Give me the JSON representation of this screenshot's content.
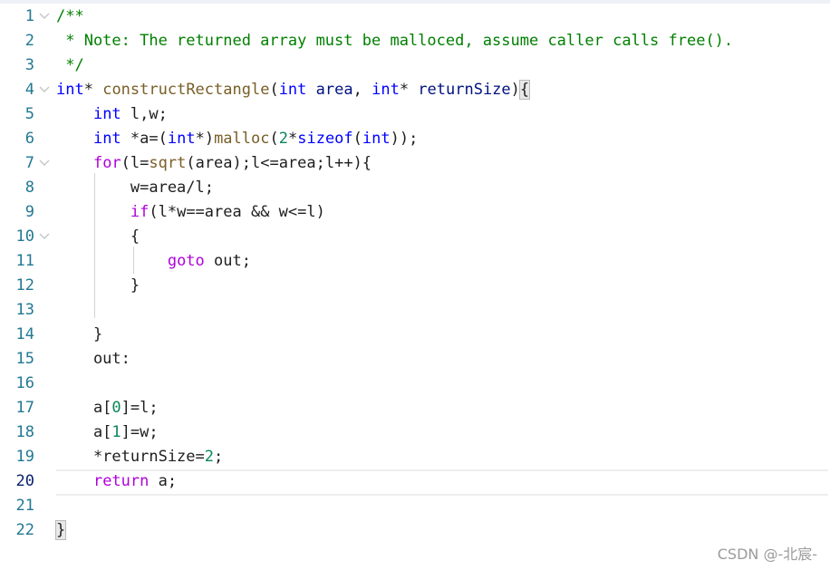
{
  "editor": {
    "lines": [
      {
        "number": "1",
        "fold": true,
        "tokens": [
          {
            "t": "/**",
            "c": "comment"
          }
        ]
      },
      {
        "number": "2",
        "tokens": [
          {
            "t": " * Note: The returned array must be malloced, assume caller calls free().",
            "c": "comment"
          }
        ]
      },
      {
        "number": "3",
        "tokens": [
          {
            "t": " */",
            "c": "comment"
          }
        ]
      },
      {
        "number": "4",
        "fold": true,
        "tokens": [
          {
            "t": "int",
            "c": "kw"
          },
          {
            "t": "* ",
            "c": "plain"
          },
          {
            "t": "constructRectangle",
            "c": "fn"
          },
          {
            "t": "(",
            "c": "punc"
          },
          {
            "t": "int",
            "c": "kw"
          },
          {
            "t": " ",
            "c": "plain"
          },
          {
            "t": "area",
            "c": "param"
          },
          {
            "t": ", ",
            "c": "plain"
          },
          {
            "t": "int",
            "c": "kw"
          },
          {
            "t": "* ",
            "c": "plain"
          },
          {
            "t": "returnSize",
            "c": "param"
          },
          {
            "t": ")",
            "c": "punc"
          },
          {
            "t": "{",
            "c": "bracket"
          }
        ]
      },
      {
        "number": "5",
        "tokens": [
          {
            "t": "    ",
            "c": "plain"
          },
          {
            "t": "int",
            "c": "kw"
          },
          {
            "t": " l,w;",
            "c": "plain"
          }
        ]
      },
      {
        "number": "6",
        "tokens": [
          {
            "t": "    ",
            "c": "plain"
          },
          {
            "t": "int",
            "c": "kw"
          },
          {
            "t": " *a=(",
            "c": "plain"
          },
          {
            "t": "int",
            "c": "kw"
          },
          {
            "t": "*)",
            "c": "plain"
          },
          {
            "t": "malloc",
            "c": "fn"
          },
          {
            "t": "(",
            "c": "plain"
          },
          {
            "t": "2",
            "c": "num"
          },
          {
            "t": "*",
            "c": "plain"
          },
          {
            "t": "sizeof",
            "c": "kw"
          },
          {
            "t": "(",
            "c": "plain"
          },
          {
            "t": "int",
            "c": "kw"
          },
          {
            "t": "));",
            "c": "plain"
          }
        ]
      },
      {
        "number": "7",
        "fold": true,
        "tokens": [
          {
            "t": "    ",
            "c": "plain"
          },
          {
            "t": "for",
            "c": "ctl"
          },
          {
            "t": "(l=",
            "c": "plain"
          },
          {
            "t": "sqrt",
            "c": "fn"
          },
          {
            "t": "(area);l<=area;l++){",
            "c": "plain"
          }
        ]
      },
      {
        "number": "8",
        "tokens": [
          {
            "t": "        w=area/l;",
            "c": "plain"
          }
        ]
      },
      {
        "number": "9",
        "tokens": [
          {
            "t": "        ",
            "c": "plain"
          },
          {
            "t": "if",
            "c": "ctl"
          },
          {
            "t": "(l*w==area && w<=l)",
            "c": "plain"
          }
        ]
      },
      {
        "number": "10",
        "fold": true,
        "tokens": [
          {
            "t": "        {",
            "c": "plain"
          }
        ]
      },
      {
        "number": "11",
        "tokens": [
          {
            "t": "            ",
            "c": "plain"
          },
          {
            "t": "goto",
            "c": "ctl"
          },
          {
            "t": " out;",
            "c": "plain"
          }
        ]
      },
      {
        "number": "12",
        "tokens": [
          {
            "t": "        }",
            "c": "plain"
          }
        ]
      },
      {
        "number": "13",
        "tokens": []
      },
      {
        "number": "14",
        "tokens": [
          {
            "t": "    }",
            "c": "plain"
          }
        ]
      },
      {
        "number": "15",
        "tokens": [
          {
            "t": "    out:",
            "c": "plain"
          }
        ]
      },
      {
        "number": "16",
        "tokens": []
      },
      {
        "number": "17",
        "tokens": [
          {
            "t": "    a[",
            "c": "plain"
          },
          {
            "t": "0",
            "c": "num"
          },
          {
            "t": "]=l;",
            "c": "plain"
          }
        ]
      },
      {
        "number": "18",
        "tokens": [
          {
            "t": "    a[",
            "c": "plain"
          },
          {
            "t": "1",
            "c": "num"
          },
          {
            "t": "]=w;",
            "c": "plain"
          }
        ]
      },
      {
        "number": "19",
        "tokens": [
          {
            "t": "    *returnSize=",
            "c": "plain"
          },
          {
            "t": "2",
            "c": "num"
          },
          {
            "t": ";",
            "c": "plain"
          }
        ]
      },
      {
        "number": "20",
        "active": true,
        "tokens": [
          {
            "t": "    ",
            "c": "plain"
          },
          {
            "t": "return",
            "c": "ctl"
          },
          {
            "t": " a;",
            "c": "plain"
          }
        ]
      },
      {
        "number": "21",
        "tokens": []
      },
      {
        "number": "22",
        "tokens": [
          {
            "t": "}",
            "c": "bracket"
          }
        ]
      }
    ]
  },
  "watermark": "CSDN @-北宸-",
  "colors": {
    "comment": "#008000",
    "keyword": "#0000ff",
    "control": "#af00db",
    "function": "#795e26",
    "parameter": "#001080",
    "number": "#098658",
    "line_number": "#237893",
    "active_line_number": "#0b216f"
  }
}
